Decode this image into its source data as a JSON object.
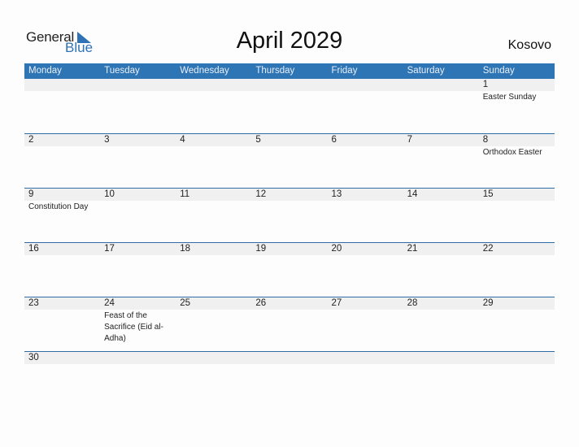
{
  "brand": {
    "general": "General",
    "blue": "Blue",
    "accent": "#2e75b6"
  },
  "title": "April 2029",
  "country": "Kosovo",
  "weekdays": [
    "Monday",
    "Tuesday",
    "Wednesday",
    "Thursday",
    "Friday",
    "Saturday",
    "Sunday"
  ],
  "weeks": [
    [
      {
        "d": "",
        "e": ""
      },
      {
        "d": "",
        "e": ""
      },
      {
        "d": "",
        "e": ""
      },
      {
        "d": "",
        "e": ""
      },
      {
        "d": "",
        "e": ""
      },
      {
        "d": "",
        "e": ""
      },
      {
        "d": "1",
        "e": "Easter Sunday"
      }
    ],
    [
      {
        "d": "2",
        "e": ""
      },
      {
        "d": "3",
        "e": ""
      },
      {
        "d": "4",
        "e": ""
      },
      {
        "d": "5",
        "e": ""
      },
      {
        "d": "6",
        "e": ""
      },
      {
        "d": "7",
        "e": ""
      },
      {
        "d": "8",
        "e": "Orthodox Easter"
      }
    ],
    [
      {
        "d": "9",
        "e": "Constitution Day"
      },
      {
        "d": "10",
        "e": ""
      },
      {
        "d": "11",
        "e": ""
      },
      {
        "d": "12",
        "e": ""
      },
      {
        "d": "13",
        "e": ""
      },
      {
        "d": "14",
        "e": ""
      },
      {
        "d": "15",
        "e": ""
      }
    ],
    [
      {
        "d": "16",
        "e": ""
      },
      {
        "d": "17",
        "e": ""
      },
      {
        "d": "18",
        "e": ""
      },
      {
        "d": "19",
        "e": ""
      },
      {
        "d": "20",
        "e": ""
      },
      {
        "d": "21",
        "e": ""
      },
      {
        "d": "22",
        "e": ""
      }
    ],
    [
      {
        "d": "23",
        "e": ""
      },
      {
        "d": "24",
        "e": "Feast of the Sacrifice (Eid al-Adha)"
      },
      {
        "d": "25",
        "e": ""
      },
      {
        "d": "26",
        "e": ""
      },
      {
        "d": "27",
        "e": ""
      },
      {
        "d": "28",
        "e": ""
      },
      {
        "d": "29",
        "e": ""
      }
    ],
    [
      {
        "d": "30",
        "e": ""
      },
      {
        "d": "",
        "e": ""
      },
      {
        "d": "",
        "e": ""
      },
      {
        "d": "",
        "e": ""
      },
      {
        "d": "",
        "e": ""
      },
      {
        "d": "",
        "e": ""
      },
      {
        "d": "",
        "e": ""
      }
    ]
  ]
}
